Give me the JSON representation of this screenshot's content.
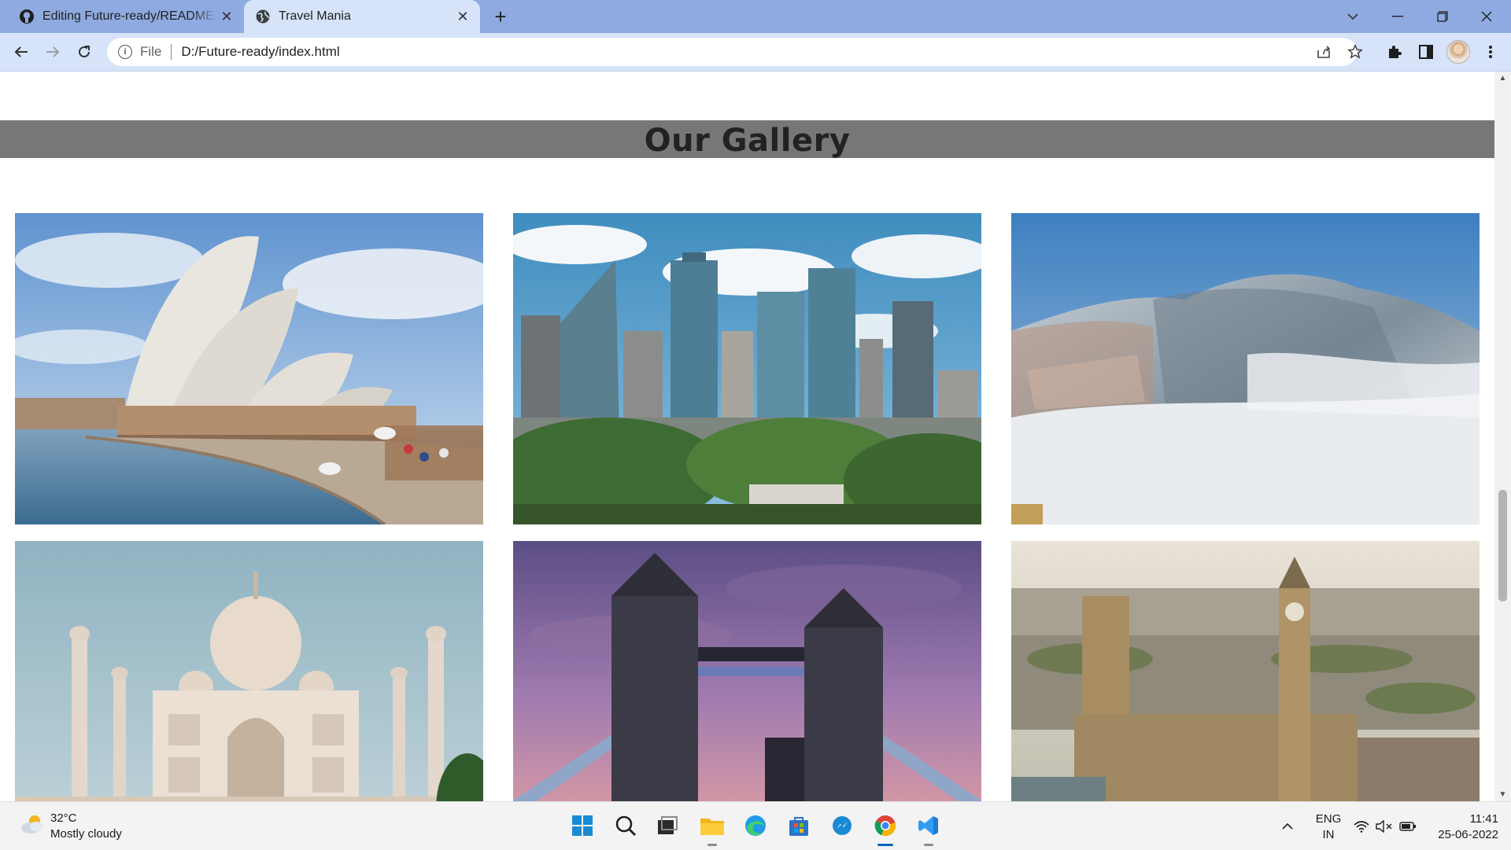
{
  "tabs": [
    {
      "label": "Editing Future-ready/README.md",
      "active": false,
      "icon": "github-icon"
    },
    {
      "label": "Travel Mania",
      "active": true,
      "icon": "globe-icon"
    }
  ],
  "toolbar": {
    "scheme_label": "File",
    "url": "D:/Future-ready/index.html"
  },
  "page": {
    "gallery_title": "Our Gallery",
    "photos": [
      {
        "subject": "Sydney Opera House"
      },
      {
        "subject": "City skyline"
      },
      {
        "subject": "Snow-covered hill town"
      },
      {
        "subject": "Taj Mahal"
      },
      {
        "subject": "Tower Bridge at dusk"
      },
      {
        "subject": "Palace of Westminster and Big Ben"
      }
    ]
  },
  "taskbar": {
    "weather_temp": "32°C",
    "weather_desc": "Mostly cloudy",
    "lang_top": "ENG",
    "lang_bottom": "IN",
    "time": "11:41",
    "date": "25-06-2022"
  },
  "colors": {
    "titlebar": "#8eaae0",
    "toolbar": "#d6e3f8",
    "gallery_band": "#777777",
    "taskbar": "#f3f3f3"
  }
}
